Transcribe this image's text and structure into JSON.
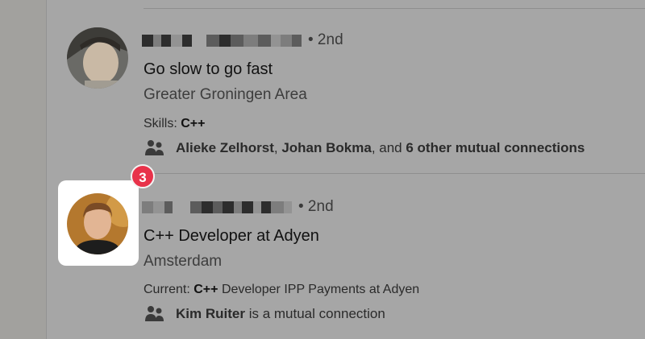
{
  "results": [
    {
      "degree": "• 2nd",
      "headline": "Go slow to go fast",
      "location": "Greater Groningen Area",
      "detail_label": "Skills:",
      "detail_bold": "C++",
      "detail_rest": "",
      "mutual_a": "Alieke Zelhorst",
      "mutual_sep1": ", ",
      "mutual_b": "Johan Bokma",
      "mutual_sep2": ", and ",
      "mutual_c": "6 other mutual connections"
    },
    {
      "degree": "• 2nd",
      "headline": "C++ Developer at Adyen",
      "location": "Amsterdam",
      "detail_label": "Current:",
      "detail_bold": "C++",
      "detail_rest": "Developer IPP Payments at Adyen",
      "mutual_a": "Kim Ruiter",
      "mutual_rest": " is a mutual connection"
    }
  ],
  "badge": "3",
  "colors": {
    "badge": "#e8324a",
    "highlight": "#ffffff"
  },
  "icons": {
    "mutual": "people-icon"
  }
}
